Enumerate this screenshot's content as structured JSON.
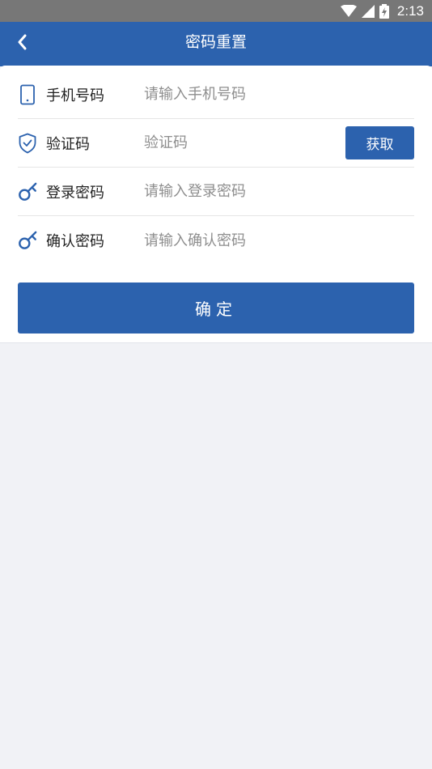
{
  "status_bar": {
    "time": "2:13"
  },
  "nav": {
    "title": "密码重置",
    "back_icon": "chevron-left-icon"
  },
  "form": {
    "phone": {
      "label": "手机号码",
      "placeholder": "请输入手机号码",
      "icon": "phone-icon"
    },
    "code": {
      "label": "验证码",
      "placeholder": "验证码",
      "icon": "shield-check-icon",
      "button_label": "获取"
    },
    "password": {
      "label": "登录密码",
      "placeholder": "请输入登录密码",
      "icon": "key-icon"
    },
    "confirm_password": {
      "label": "确认密码",
      "placeholder": "请输入确认密码",
      "icon": "key-icon"
    }
  },
  "confirm_button": {
    "label": "确定"
  },
  "colors": {
    "primary": "#2c62ae",
    "background": "#f1f2f6",
    "status_bar": "#777777"
  }
}
